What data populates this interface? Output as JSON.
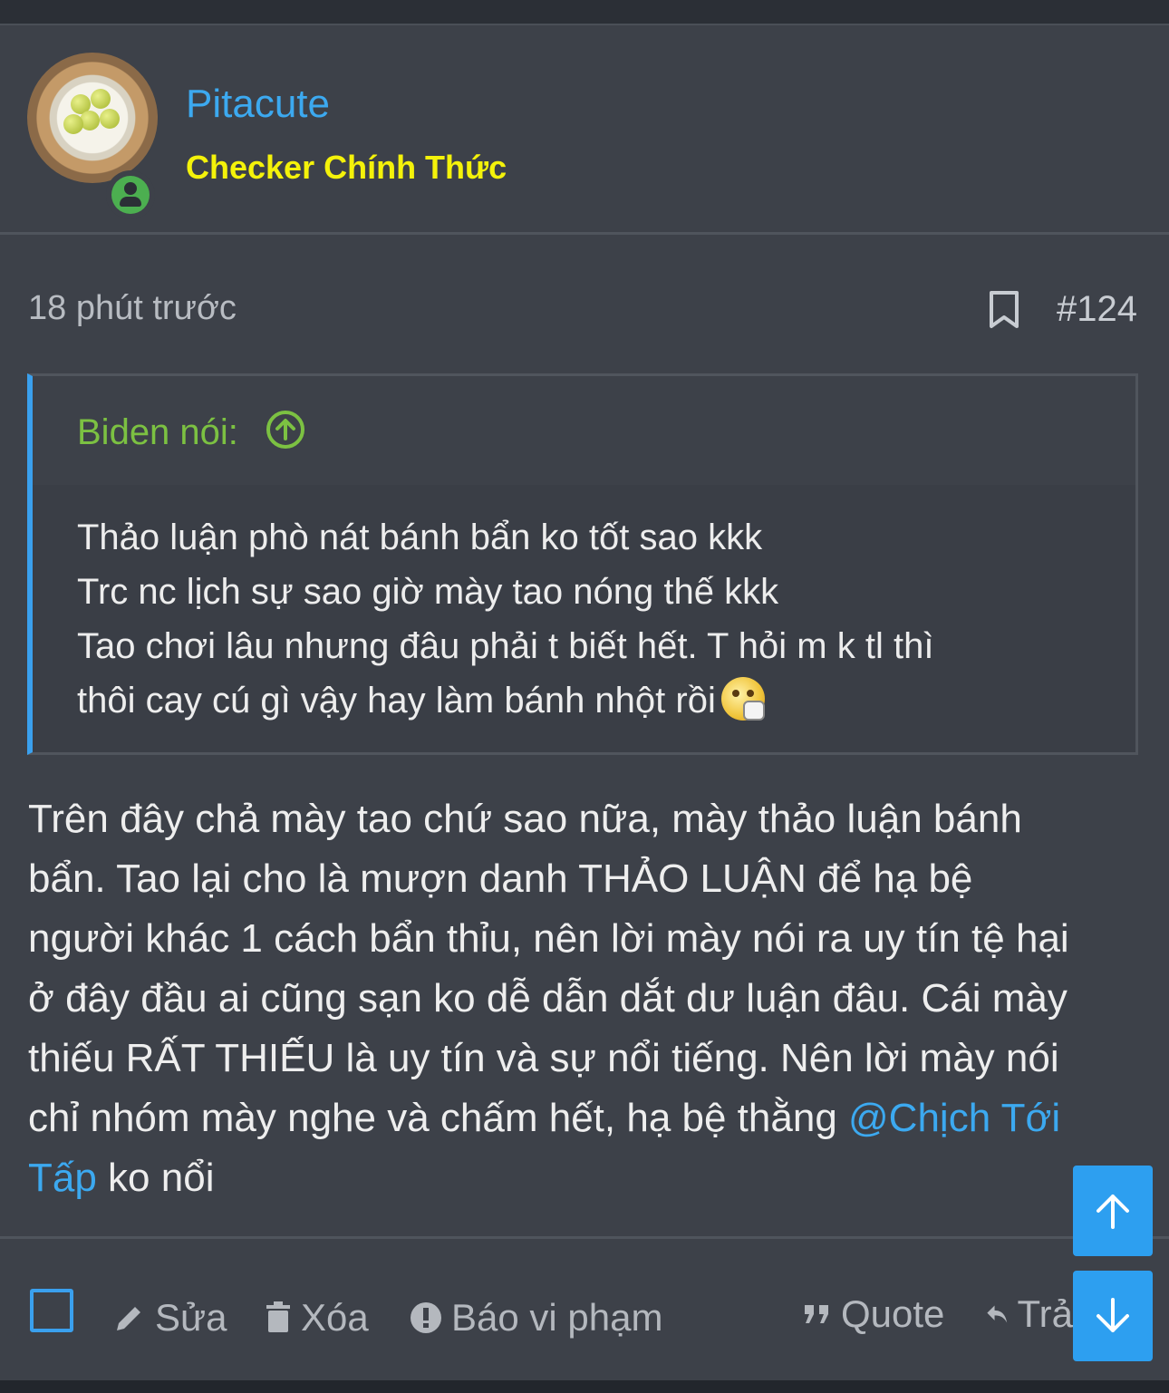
{
  "user": {
    "name": "Pitacute",
    "title": "Checker Chính Thức"
  },
  "post": {
    "time": "18 phút trước",
    "number": "#124",
    "quote": {
      "author": "Biden nói:",
      "lines": [
        "Thảo luận phò nát bánh bẩn ko tốt sao kkk",
        "Trc nc lịch sự sao giờ mày tao nóng thế kkk",
        "Tao chơi lâu nhưng đâu phải t biết hết. T hỏi m k tl thì",
        "thôi cay cú gì vậy hay làm bánh nhột rồi"
      ]
    },
    "body": {
      "lines": [
        "Trên đây chả mày tao chứ sao nữa, mày thảo luận bánh",
        "bẩn. Tao lại cho là mượn danh THẢO LUẬN để hạ bệ",
        "người khác 1 cách bẩn thỉu, nên lời mày nói ra uy tín tệ hại",
        "ở đây đầu ai cũng sạn ko dễ dẫn dắt dư luận đâu. Cái mày",
        "thiếu RẤT THIẾU là uy tín và sự nổi tiếng. Nên lời mày nói",
        "chỉ nhóm mày nghe và chấm hết, hạ bệ thằng "
      ],
      "mention_part1": "@Chịch Tới",
      "mention_part2": "Tấp",
      "tail": " ko nổi"
    }
  },
  "actions": {
    "edit": "Sửa",
    "delete": "Xóa",
    "report": "Báo vi phạm",
    "quote": "Quote",
    "reply": "Trả"
  },
  "colors": {
    "accent": "#3ca9f0",
    "title": "#f4f20a",
    "quote_author": "#7cc142",
    "online": "#4caf50"
  }
}
